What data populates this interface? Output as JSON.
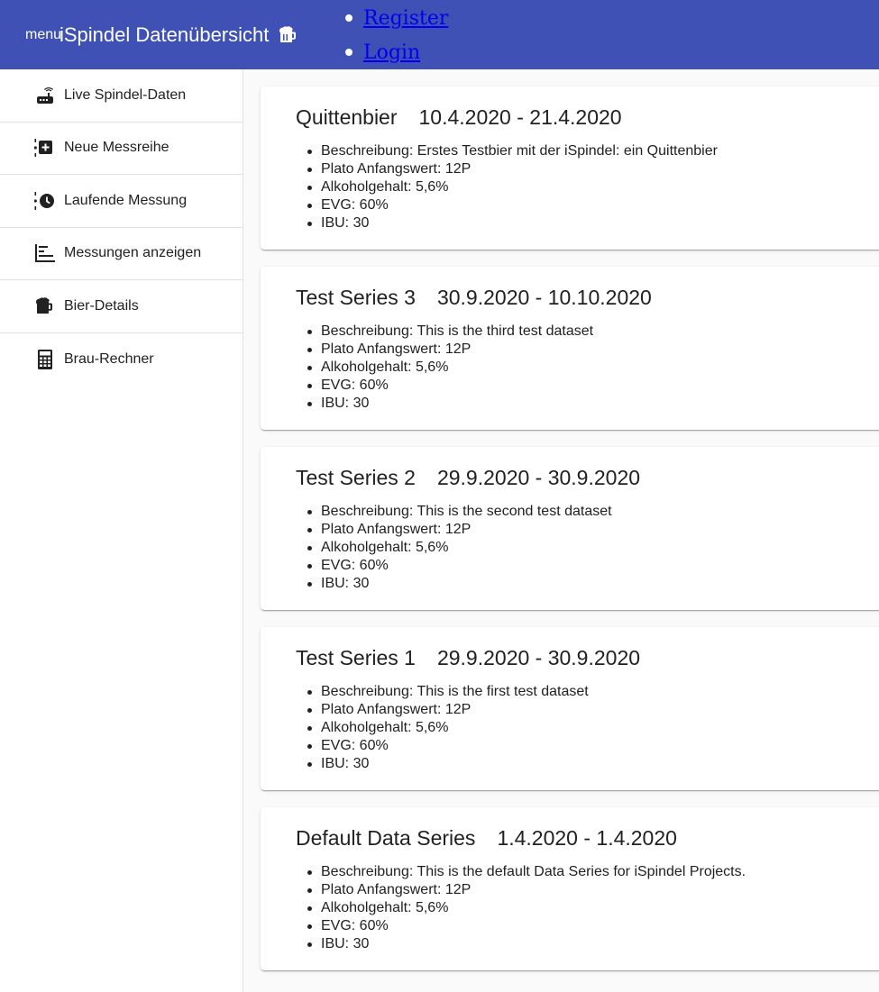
{
  "toolbar": {
    "menu_label": "menu",
    "title": "iSpindel Datenübersicht",
    "title_icon": "beer-mug-icon",
    "nav": [
      {
        "label": "Register"
      },
      {
        "label": "Login"
      }
    ]
  },
  "sidebar": {
    "items": [
      {
        "label": "Live Spindel-Daten",
        "icon": "router-icon"
      },
      {
        "label": "Neue Messreihe",
        "icon": "timeline-add-icon"
      },
      {
        "label": "Laufende Messung",
        "icon": "timeline-clock-icon"
      },
      {
        "label": "Messungen anzeigen",
        "icon": "bar-list-icon"
      },
      {
        "label": "Bier-Details",
        "icon": "beer-mug-icon"
      },
      {
        "label": "Brau-Rechner",
        "icon": "calculator-icon"
      }
    ]
  },
  "series": [
    {
      "name": "Quittenbier",
      "date": "10.4.2020 - 21.4.2020",
      "details": [
        "Beschreibung: Erstes Testbier mit der iSpindel: ein Quittenbier",
        "Plato Anfangswert: 12P",
        "Alkoholgehalt: 5,6%",
        "EVG: 60%",
        "IBU: 30"
      ]
    },
    {
      "name": "Test Series 3",
      "date": "30.9.2020 - 10.10.2020",
      "details": [
        "Beschreibung: This is the third test dataset",
        "Plato Anfangswert: 12P",
        "Alkoholgehalt: 5,6%",
        "EVG: 60%",
        "IBU: 30"
      ]
    },
    {
      "name": "Test Series 2",
      "date": "29.9.2020 - 30.9.2020",
      "details": [
        "Beschreibung: This is the second test dataset",
        "Plato Anfangswert: 12P",
        "Alkoholgehalt: 5,6%",
        "EVG: 60%",
        "IBU: 30"
      ]
    },
    {
      "name": "Test Series 1",
      "date": "29.9.2020 - 30.9.2020",
      "details": [
        "Beschreibung: This is the first test dataset",
        "Plato Anfangswert: 12P",
        "Alkoholgehalt: 5,6%",
        "EVG: 60%",
        "IBU: 30"
      ]
    },
    {
      "name": "Default Data Series",
      "date": "1.4.2020 - 1.4.2020",
      "details": [
        "Beschreibung: This is the default Data Series for iSpindel Projects.",
        "Plato Anfangswert: 12P",
        "Alkoholgehalt: 5,6%",
        "EVG: 60%",
        "IBU: 30"
      ]
    }
  ]
}
